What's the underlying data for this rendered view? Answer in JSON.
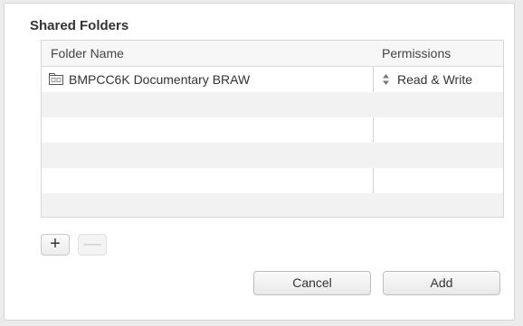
{
  "dialog": {
    "title": "Shared Folders"
  },
  "table": {
    "columns": {
      "name": "Folder Name",
      "permissions": "Permissions"
    },
    "rows": [
      {
        "name": "BMPCC6K Documentary BRAW",
        "permissions": "Read & Write",
        "icon": "folder-icon"
      }
    ]
  },
  "toolbar": {
    "add_row_label": "+",
    "remove_row_label": "—"
  },
  "buttons": {
    "cancel": "Cancel",
    "add": "Add"
  },
  "colors": {
    "window_bg": "#ececec",
    "dialog_bg": "#ffffff",
    "stripe": "#f2f2f2",
    "border": "#d6d6d6"
  }
}
